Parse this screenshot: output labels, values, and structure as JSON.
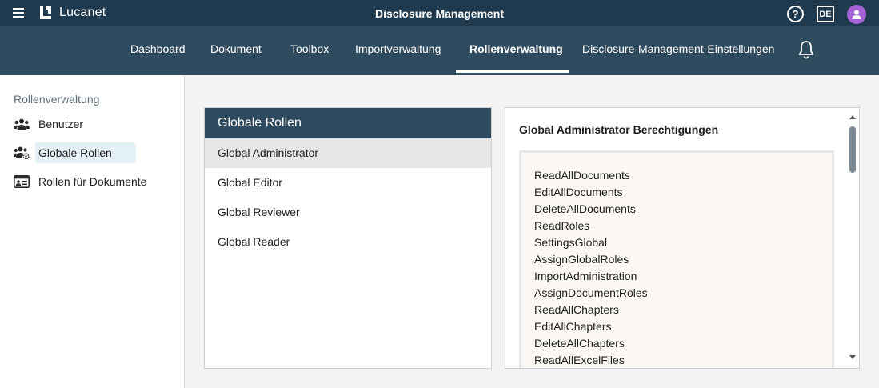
{
  "topbar": {
    "brand": "Lucanet",
    "title": "Disclosure Management",
    "help_glyph": "?",
    "language": "DE"
  },
  "nav": {
    "tabs": [
      {
        "label": "Dashboard"
      },
      {
        "label": "Dokument"
      },
      {
        "label": "Toolbox"
      },
      {
        "label": "Importverwaltung"
      },
      {
        "label": "Rollenverwaltung"
      },
      {
        "label": "Disclosure-Management-Einstellungen"
      }
    ],
    "active": "Rollenverwaltung"
  },
  "sidebar": {
    "title": "Rollenverwaltung",
    "items": [
      {
        "label": "Benutzer",
        "icon": "users-icon"
      },
      {
        "label": "Globale Rollen",
        "icon": "users-gear-icon"
      },
      {
        "label": "Rollen für Dokumente",
        "icon": "id-card-icon"
      }
    ],
    "active": "Globale Rollen"
  },
  "roles": {
    "header": "Globale Rollen",
    "items": [
      {
        "label": "Global Administrator"
      },
      {
        "label": "Global Editor"
      },
      {
        "label": "Global Reviewer"
      },
      {
        "label": "Global Reader"
      }
    ],
    "selected": "Global Administrator"
  },
  "permissions": {
    "title": "Global Administrator Berechtigungen",
    "items": [
      "ReadAllDocuments",
      "EditAllDocuments",
      "DeleteAllDocuments",
      "ReadRoles",
      "SettingsGlobal",
      "AssignGlobalRoles",
      "ImportAdministration",
      "AssignDocumentRoles",
      "ReadAllChapters",
      "EditAllChapters",
      "DeleteAllChapters",
      "ReadAllExcelFiles"
    ]
  },
  "colors": {
    "topbar": "#1f3a4f",
    "navbar": "#2f4b60",
    "avatar": "#a463d6",
    "sidebar_active": "#e3f1f7",
    "perm_box": "#fcf8f3"
  }
}
